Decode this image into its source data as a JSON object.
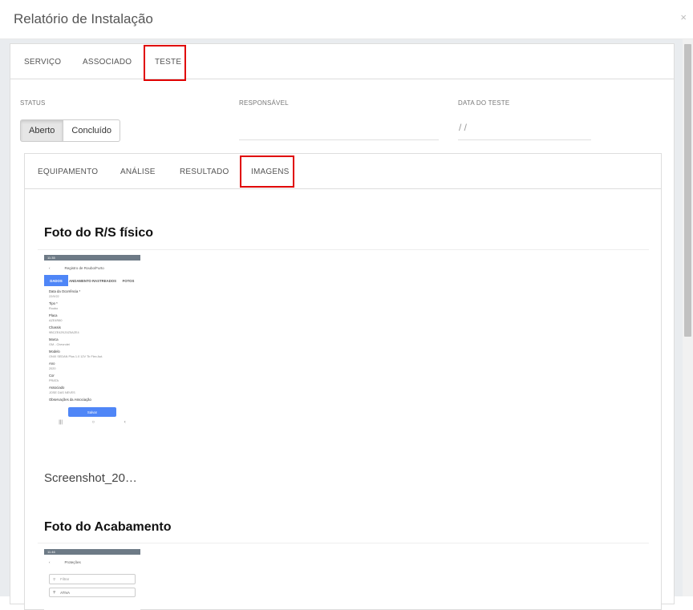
{
  "modal": {
    "title": "Relatório de Instalação",
    "close_label": "×"
  },
  "top_tabs": [
    {
      "label": "SERVIÇO"
    },
    {
      "label": "ASSOCIADO"
    },
    {
      "label": "TESTE",
      "active": true
    }
  ],
  "fields": {
    "status_label": "STATUS",
    "responsavel_label": "RESPONSÁVEL",
    "data_label": "DATA DO TESTE",
    "data_value": "/ /",
    "status_options": [
      {
        "label": "Aberto",
        "active": true
      },
      {
        "label": "Concluído"
      }
    ]
  },
  "inner_tabs": [
    {
      "label": "EQUIPAMENTO"
    },
    {
      "label": "ANÁLISE"
    },
    {
      "label": "RESULTADO"
    },
    {
      "label": "IMAGENS",
      "active": true
    }
  ],
  "sections": [
    {
      "title": "Foto do R/S físico",
      "caption": "Screenshot_20…"
    },
    {
      "title": "Foto do Acabamento"
    }
  ],
  "phone1": {
    "status_time": "11:35",
    "appbar_title": "Registro de Roubo/Furto",
    "tabs": [
      "DADOS",
      "ANDAMENTO",
      "RASTREADOS",
      "FOTOS"
    ],
    "rows": [
      {
        "label": "Data da Ocorrência *",
        "value": "22/9/22"
      },
      {
        "label": "Tipo *",
        "value": "Roubo"
      },
      {
        "label": "Placa",
        "value": "AZE4R80"
      },
      {
        "label": "Chassis",
        "value": "9BCZE4ZKZ4Z5AZE4"
      },
      {
        "label": "Marca",
        "value": "GM - Chevrolet"
      },
      {
        "label": "Modelo",
        "value": "ONIX SEDAN Plus 1.0 12V Tb Flex Aut."
      },
      {
        "label": "Ano",
        "value": "2020"
      },
      {
        "label": "Cor",
        "value": "PRATA"
      },
      {
        "label": "Associado",
        "value": "JOSE DAS NEVES"
      },
      {
        "label": "Observações da Associação",
        "value": ""
      }
    ],
    "save_label": "Salvar"
  },
  "phone2": {
    "status_time": "11:46",
    "appbar_title": "Proteções",
    "search_placeholder": "Filtrar",
    "select_value": "ATIVA"
  }
}
